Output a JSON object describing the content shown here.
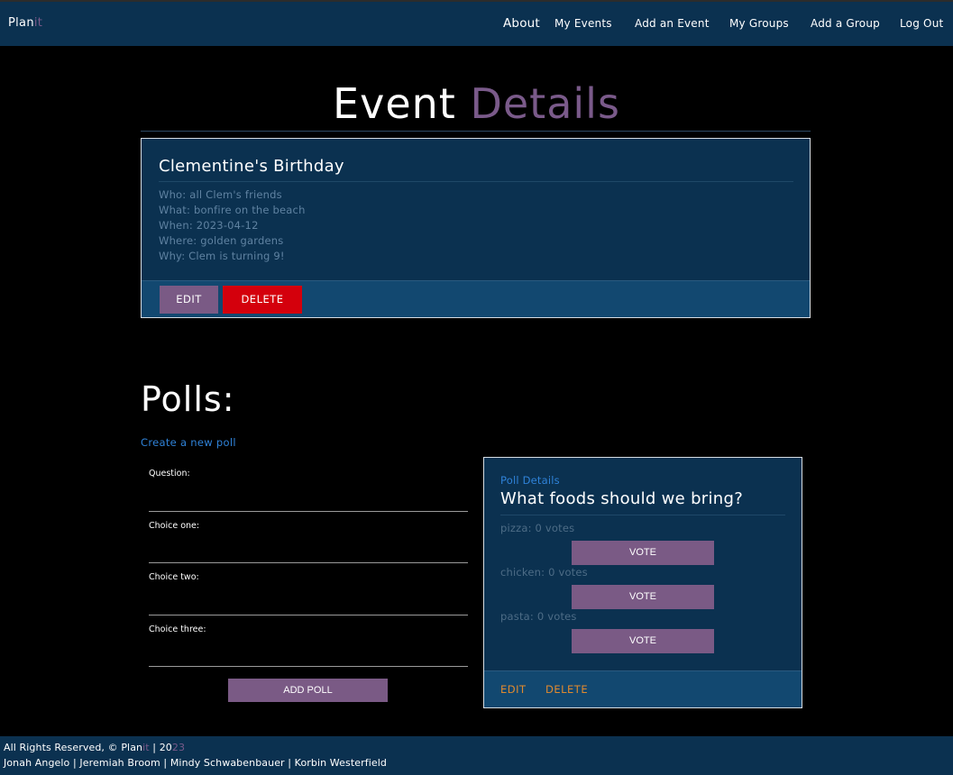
{
  "nav": {
    "brand_main": "Plan",
    "brand_accent": "it",
    "items": [
      "About",
      "My Events",
      "Add an Event",
      "My Groups",
      "Add a Group",
      "Log Out"
    ]
  },
  "header": {
    "title_main": "Event",
    "title_accent": "Details"
  },
  "event": {
    "title": "Clementine's Birthday",
    "who": "Who: all Clem's friends",
    "what": "What: bonfire on the beach",
    "when": "When: 2023-04-12",
    "where": "Where: golden gardens",
    "why": "Why: Clem is turning 9!",
    "edit_label": "EDIT",
    "delete_label": "DELETE"
  },
  "polls": {
    "heading": "Polls:",
    "create_link": "Create a new poll",
    "form": {
      "question_label": "Question:",
      "choice_one_label": "Choice one:",
      "choice_two_label": "Choice two:",
      "choice_three_label": "Choice three:",
      "question_value": "",
      "choice_one_value": "",
      "choice_two_value": "",
      "choice_three_value": "",
      "submit_label": "ADD POLL"
    },
    "card": {
      "subtitle": "Poll Details",
      "question": "What foods should we bring?",
      "choices": [
        {
          "text": "pizza: 0 votes",
          "vote_label": "VOTE"
        },
        {
          "text": "chicken: 0 votes",
          "vote_label": "VOTE"
        },
        {
          "text": "pasta: 0 votes",
          "vote_label": "VOTE"
        }
      ],
      "edit_label": "EDIT",
      "delete_label": "DELETE"
    }
  },
  "footer": {
    "rights_prefix": "All Rights Reserved, © Plan",
    "rights_brand_accent": "it",
    "rights_year_prefix": " | 20",
    "rights_year_accent": "23",
    "authors": "Jonah Angelo | Jeremiah Broom | Mindy Schwabenbauer | Korbin Westerfield"
  },
  "colors": {
    "nav_bg": "#0b3150",
    "accent_purple": "#7a5a85",
    "delete_red": "#d4000c",
    "link_blue": "#2f82d8",
    "action_orange": "#e08a2e"
  }
}
